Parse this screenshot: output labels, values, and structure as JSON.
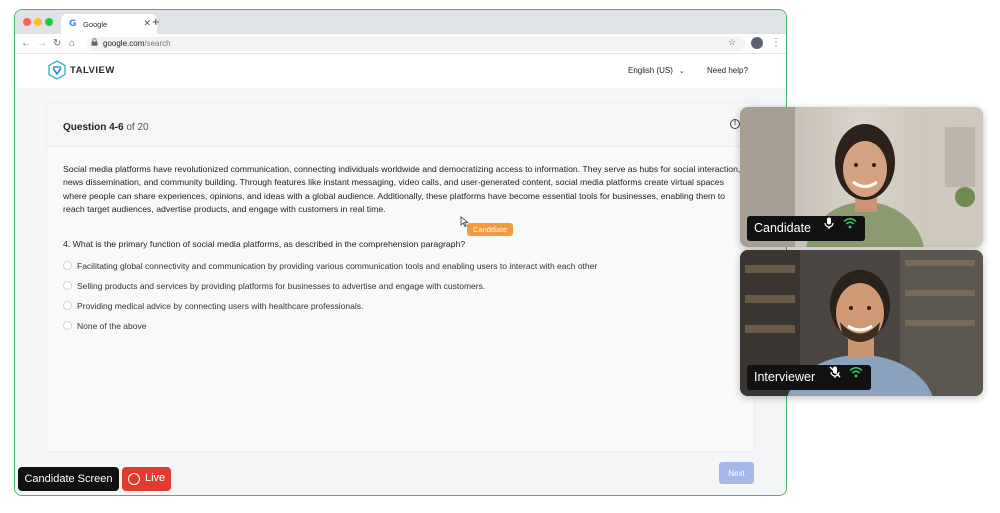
{
  "browser": {
    "tab_title": "Google",
    "tab_icon": "google-g-icon",
    "url_domain": "google.com",
    "url_path": "/search"
  },
  "header": {
    "logo_text": "TALVIEW",
    "language": "English (US)",
    "help": "Need help?"
  },
  "question": {
    "label": "Question 4-6",
    "of_text": "of 20",
    "passage": "Social media platforms have revolutionized communication, connecting individuals worldwide and democratizing access to information. They serve as hubs for social interaction, news dissemination, and community building. Through features like instant messaging, video calls, and user-generated content, social media platforms create virtual spaces where people can share experiences, opinions, and ideas with a global audience. Additionally, these platforms have become essential tools for businesses, enabling them to reach target audiences, advertise products, and engage with customers in real time.",
    "prompt": "4. What is the primary function of social media platforms, as described in the comprehension paragraph?",
    "options": [
      "Facilitating global connectivity and communication by providing various communication tools and enabling users to interact with each other",
      "Selling products and services by providing platforms for businesses to advertise and engage with customers.",
      "Providing medical advice by connecting users with healthcare professionals.",
      "None of the above"
    ]
  },
  "cursor_tag": "Canddiate",
  "next_label": "Next",
  "candidate_screen_label": "Candidate Screen",
  "live_label": "Live",
  "videos": {
    "candidate": {
      "label": "Candidate",
      "mic": "mic-icon",
      "signal": "wifi-icon"
    },
    "interviewer": {
      "label": "Interviewer",
      "mic": "mic-muted-icon",
      "signal": "wifi-icon"
    }
  },
  "colors": {
    "frame_border": "#43b86a",
    "tag_orange": "#f39a3d",
    "live_red": "#e23a2e",
    "next_disabled": "#a8b7ea",
    "signal_green": "#3ecf6a"
  }
}
